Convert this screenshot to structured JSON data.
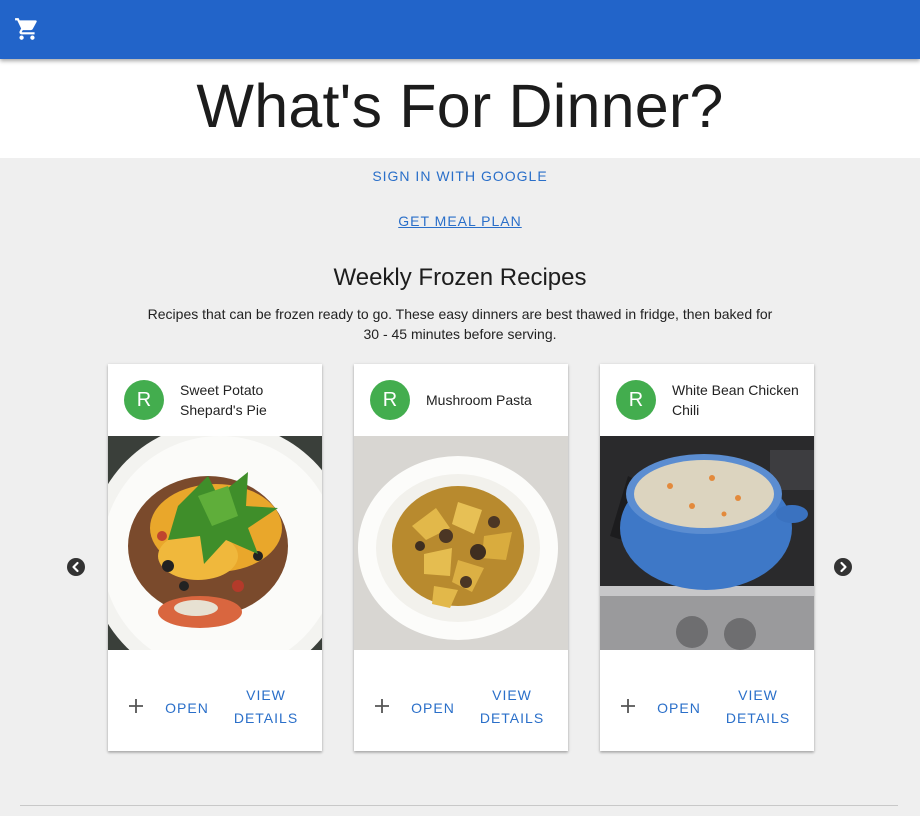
{
  "appbar": {
    "cart_icon": "shopping-cart-icon",
    "color": "#2264c9"
  },
  "header": {
    "title": "What's For Dinner?"
  },
  "actions": {
    "sign_in": "SIGN IN WITH GOOGLE",
    "meal_plan": "GET MEAL PLAN"
  },
  "section": {
    "title": "Weekly Frozen Recipes",
    "description": "Recipes that can be frozen ready to go. These easy dinners are best thawed in fridge, then baked for 30 - 45 minutes before serving."
  },
  "carousel": {
    "prev_icon": "chevron-left-icon",
    "next_icon": "chevron-right-icon",
    "cards": [
      {
        "avatar": "R",
        "title": "Sweet Potato Shepard's Pie",
        "open": "OPEN",
        "details": "VIEW DETAILS"
      },
      {
        "avatar": "R",
        "title": "Mushroom Pasta",
        "open": "OPEN",
        "details": "VIEW DETAILS"
      },
      {
        "avatar": "R",
        "title": "White Bean Chicken Chili",
        "open": "OPEN",
        "details": "VIEW DETAILS"
      }
    ]
  },
  "colors": {
    "accent": "#2a6fc9",
    "avatar": "#43ad4e",
    "background": "#efefef"
  }
}
